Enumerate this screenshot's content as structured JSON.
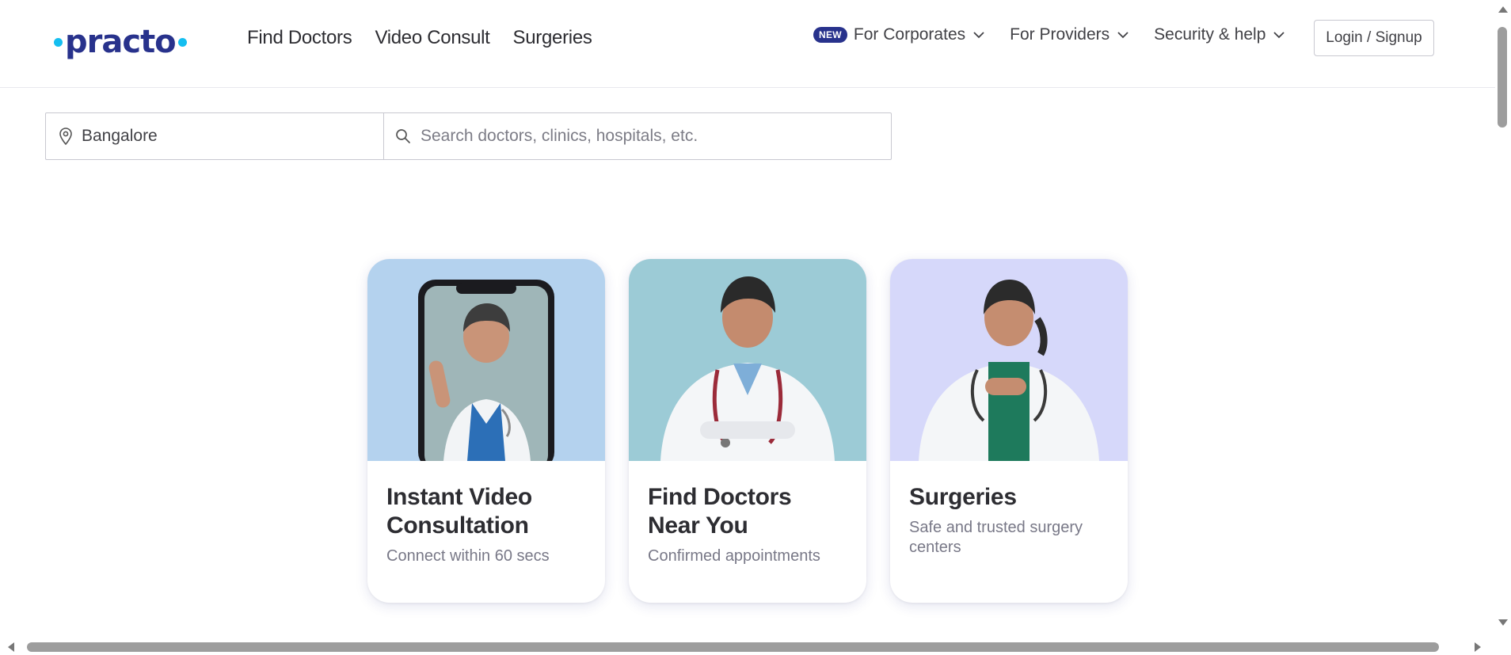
{
  "brand": {
    "name": "practo",
    "dot_color": "#14bef0",
    "word_color": "#28328c"
  },
  "header": {
    "main_nav": [
      {
        "label": "Find Doctors"
      },
      {
        "label": "Video Consult"
      },
      {
        "label": "Surgeries"
      }
    ],
    "right_nav": [
      {
        "badge": "NEW",
        "label": "For Corporates",
        "icon": "chevron-down-icon"
      },
      {
        "label": "For Providers",
        "icon": "chevron-down-icon"
      },
      {
        "label": "Security & help",
        "icon": "chevron-down-icon"
      }
    ],
    "login_label": "Login / Signup"
  },
  "search": {
    "location_value": "Bangalore",
    "location_icon": "map-pin-icon",
    "query_placeholder": "Search doctors, clinics, hospitals, etc.",
    "query_icon": "search-icon"
  },
  "cards": [
    {
      "title": "Instant Video Consultation",
      "subtitle": "Connect within 60 secs",
      "bg": "#b4d2ee"
    },
    {
      "title": "Find Doctors Near You",
      "subtitle": "Confirmed appointments",
      "bg": "#9ccbd6"
    },
    {
      "title": "Surgeries",
      "subtitle": "Safe and trusted surgery centers",
      "bg": "#d6d8fa"
    }
  ]
}
